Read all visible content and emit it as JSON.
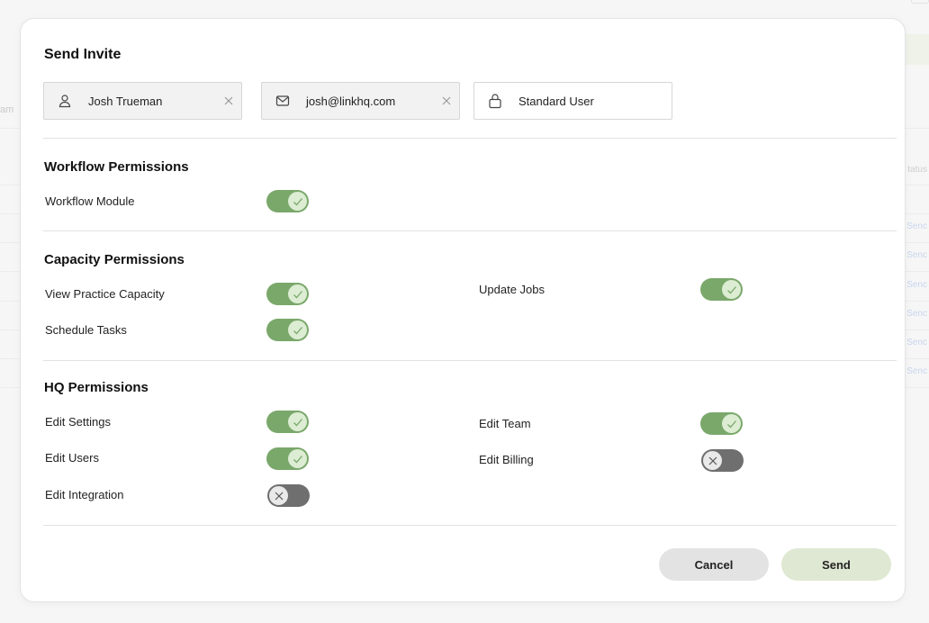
{
  "background": {
    "left_fragment": "am",
    "status_header": "tatus",
    "row_fragments": [
      "Senc",
      "Senc",
      "Senc",
      "Senc",
      "Senc",
      "Senc"
    ]
  },
  "modal": {
    "title": "Send Invite",
    "fields": {
      "name": {
        "value": "Josh Trueman",
        "icon": "user-icon"
      },
      "email": {
        "value": "josh@linkhq.com",
        "icon": "mail-icon"
      },
      "role": {
        "value": "Standard User",
        "icon": "lock-icon"
      }
    },
    "sections": [
      {
        "title": "Workflow Permissions",
        "items": [
          {
            "label": "Workflow Module",
            "enabled": true
          }
        ]
      },
      {
        "title": "Capacity Permissions",
        "items": [
          {
            "label": "View Practice Capacity",
            "enabled": true
          },
          {
            "label": "Schedule Tasks",
            "enabled": true
          },
          {
            "label": "Update Jobs",
            "enabled": true
          }
        ]
      },
      {
        "title": "HQ Permissions",
        "items": [
          {
            "label": "Edit Settings",
            "enabled": true
          },
          {
            "label": "Edit Users",
            "enabled": true
          },
          {
            "label": "Edit Integration",
            "enabled": false
          },
          {
            "label": "Edit Team",
            "enabled": true
          },
          {
            "label": "Edit Billing",
            "enabled": false
          }
        ]
      }
    ],
    "actions": {
      "cancel_label": "Cancel",
      "send_label": "Send"
    }
  },
  "colors": {
    "toggle_on": "#7aa86b",
    "toggle_off": "#6f6f6f",
    "send_button": "#dfe8d2",
    "cancel_button": "#e3e3e3"
  }
}
